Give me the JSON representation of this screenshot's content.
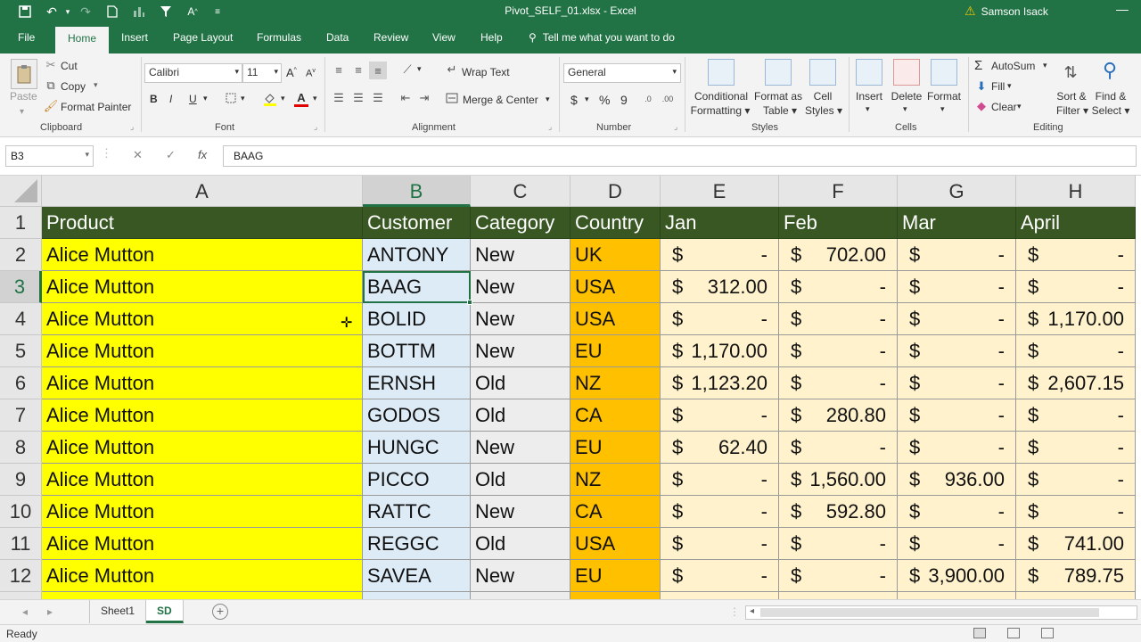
{
  "title_bar": {
    "document_title": "Pivot_SELF_01.xlsx  -  Excel",
    "user_name": "Samson Isack",
    "quick_access": [
      "save-icon",
      "undo-icon",
      "redo-icon",
      "new-icon",
      "chart-icon",
      "filter-icon",
      "font-size-icon",
      "customize-icon"
    ]
  },
  "ribbon_tabs": [
    "File",
    "Home",
    "Insert",
    "Page Layout",
    "Formulas",
    "Data",
    "Review",
    "View",
    "Help"
  ],
  "tell_me": "Tell me what you want to do",
  "ribbon": {
    "clipboard": {
      "paste": "Paste",
      "cut": "Cut",
      "copy": "Copy",
      "format_painter": "Format Painter",
      "label": "Clipboard"
    },
    "font": {
      "font_name": "Calibri",
      "font_size": "11",
      "bold": "B",
      "italic": "I",
      "underline": "U",
      "label": "Font"
    },
    "alignment": {
      "wrap_text": "Wrap Text",
      "merge_center": "Merge & Center",
      "label": "Alignment"
    },
    "number": {
      "format": "General",
      "currency": "$",
      "percent": "%",
      "comma": "9",
      "label": "Number"
    },
    "styles": {
      "conditional_formatting": [
        "Conditional",
        "Formatting"
      ],
      "format_as_table": [
        "Format as",
        "Table"
      ],
      "cell_styles": [
        "Cell",
        "Styles"
      ],
      "label": "Styles"
    },
    "cells": {
      "insert": "Insert",
      "delete": "Delete",
      "format": "Format",
      "label": "Cells"
    },
    "editing": {
      "autosum": "AutoSum",
      "fill": "Fill",
      "clear": "Clear",
      "sort_filter": [
        "Sort &",
        "Filter"
      ],
      "find_select": [
        "Find &",
        "Select"
      ],
      "label": "Editing"
    }
  },
  "formula_bar": {
    "name_box": "B3",
    "formula": "BAAG"
  },
  "columns": [
    "A",
    "B",
    "C",
    "D",
    "E",
    "F",
    "G",
    "H"
  ],
  "rows": [
    "1",
    "2",
    "3",
    "4",
    "5",
    "6",
    "7",
    "8",
    "9",
    "10",
    "11",
    "12"
  ],
  "header_row": [
    "Product",
    "Customer",
    "Category",
    "Country",
    "Jan",
    "Feb",
    "Mar",
    "April"
  ],
  "data_rows": [
    {
      "product": "Alice Mutton",
      "customer": "ANTONY",
      "category": "New",
      "country": "UK",
      "jan": "-",
      "feb": "702.00",
      "mar": "-",
      "apr": "-"
    },
    {
      "product": "Alice Mutton",
      "customer": "BAAG",
      "category": "New",
      "country": "USA",
      "jan": "312.00",
      "feb": "-",
      "mar": "-",
      "apr": "-"
    },
    {
      "product": "Alice Mutton",
      "customer": "BOLID",
      "category": "New",
      "country": "USA",
      "jan": "-",
      "feb": "-",
      "mar": "-",
      "apr": "1,170.00"
    },
    {
      "product": "Alice Mutton",
      "customer": "BOTTM",
      "category": "New",
      "country": "EU",
      "jan": "1,170.00",
      "feb": "-",
      "mar": "-",
      "apr": "-"
    },
    {
      "product": "Alice Mutton",
      "customer": "ERNSH",
      "category": "Old",
      "country": "NZ",
      "jan": "1,123.20",
      "feb": "-",
      "mar": "-",
      "apr": "2,607.15"
    },
    {
      "product": "Alice Mutton",
      "customer": "GODOS",
      "category": "Old",
      "country": "CA",
      "jan": "-",
      "feb": "280.80",
      "mar": "-",
      "apr": "-"
    },
    {
      "product": "Alice Mutton",
      "customer": "HUNGC",
      "category": "New",
      "country": "EU",
      "jan": "62.40",
      "feb": "-",
      "mar": "-",
      "apr": "-"
    },
    {
      "product": "Alice Mutton",
      "customer": "PICCO",
      "category": "Old",
      "country": "NZ",
      "jan": "-",
      "feb": "1,560.00",
      "mar": "936.00",
      "apr": "-"
    },
    {
      "product": "Alice Mutton",
      "customer": "RATTC",
      "category": "New",
      "country": "CA",
      "jan": "-",
      "feb": "592.80",
      "mar": "-",
      "apr": "-"
    },
    {
      "product": "Alice Mutton",
      "customer": "REGGC",
      "category": "Old",
      "country": "USA",
      "jan": "-",
      "feb": "-",
      "mar": "-",
      "apr": "741.00"
    },
    {
      "product": "Alice Mutton",
      "customer": "SAVEA",
      "category": "New",
      "country": "EU",
      "jan": "-",
      "feb": "-",
      "mar": "3,900.00",
      "apr": "789.75"
    }
  ],
  "currency_symbol": "$",
  "active_cell": "B3",
  "sheet_tabs": [
    "Sheet1",
    "SD"
  ],
  "active_sheet": "SD",
  "status": "Ready",
  "colors": {
    "excel_green": "#217346",
    "header_fill": "#385723",
    "product_fill": "#ffff00",
    "customer_fill": "#ddebf7",
    "category_fill": "#ededed",
    "country_fill": "#ffc000",
    "month_fill": "#fff2cc"
  }
}
